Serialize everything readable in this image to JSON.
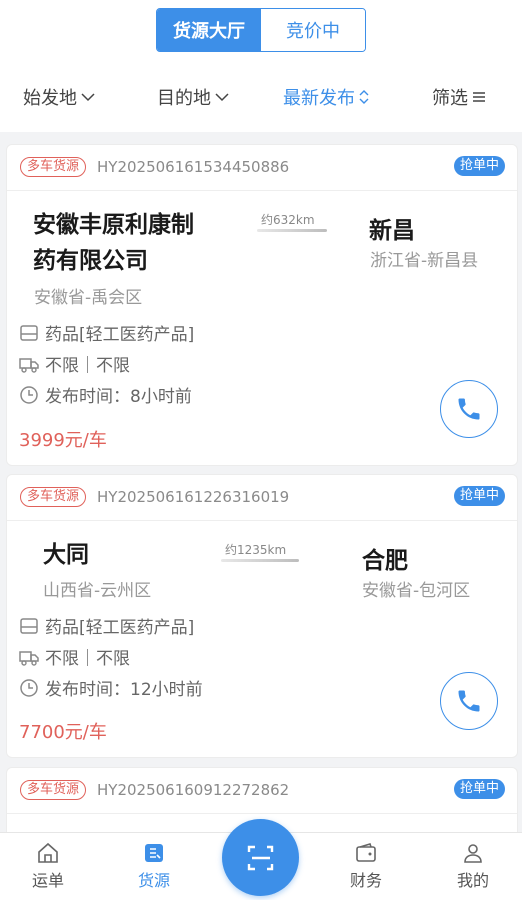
{
  "header": {
    "tabs": [
      {
        "label": "货源大厅",
        "active": true
      },
      {
        "label": "竞价中",
        "active": false
      }
    ]
  },
  "filters": [
    {
      "label": "始发地",
      "icon": "chevron-down-icon"
    },
    {
      "label": "目的地",
      "icon": "chevron-down-icon"
    },
    {
      "label": "最新发布",
      "icon": "sort-icon",
      "active": true
    },
    {
      "label": "筛选",
      "icon": "menu-icon"
    }
  ],
  "cards": [
    {
      "tag": "多车货源",
      "order_no": "HY202506161534450886",
      "status": "抢单中",
      "from_name_line1": "安徽丰原利康制",
      "from_name_line2": "药有限公司",
      "from_area": "安徽省-禹会区",
      "distance": "约632km",
      "to_name": "新昌",
      "to_area": "浙江省-新昌县",
      "cargo": "药品[轻工医药产品]",
      "vehicle": "不限｜不限",
      "publish": "发布时间：8小时前",
      "price": "3999元/车"
    },
    {
      "tag": "多车货源",
      "order_no": "HY202506161226316019",
      "status": "抢单中",
      "from_name_line1": "大同",
      "from_area": "山西省-云州区",
      "distance": "约1235km",
      "to_name": "合肥",
      "to_area": "安徽省-包河区",
      "cargo": "药品[轻工医药产品]",
      "vehicle": "不限｜不限",
      "publish": "发布时间：12小时前",
      "price": "7700元/车"
    },
    {
      "tag": "多车货源",
      "order_no": "HY202506160912272862",
      "status": "抢单中"
    }
  ],
  "tabbar": [
    {
      "label": "运单",
      "icon": "home-icon"
    },
    {
      "label": "货源",
      "icon": "cargo-icon",
      "active": true
    },
    {
      "label": "",
      "icon": "scan-icon"
    },
    {
      "label": "财务",
      "icon": "wallet-icon"
    },
    {
      "label": "我的",
      "icon": "user-icon"
    }
  ],
  "colors": {
    "accent": "#3d8fe8",
    "price": "#e0615a"
  }
}
